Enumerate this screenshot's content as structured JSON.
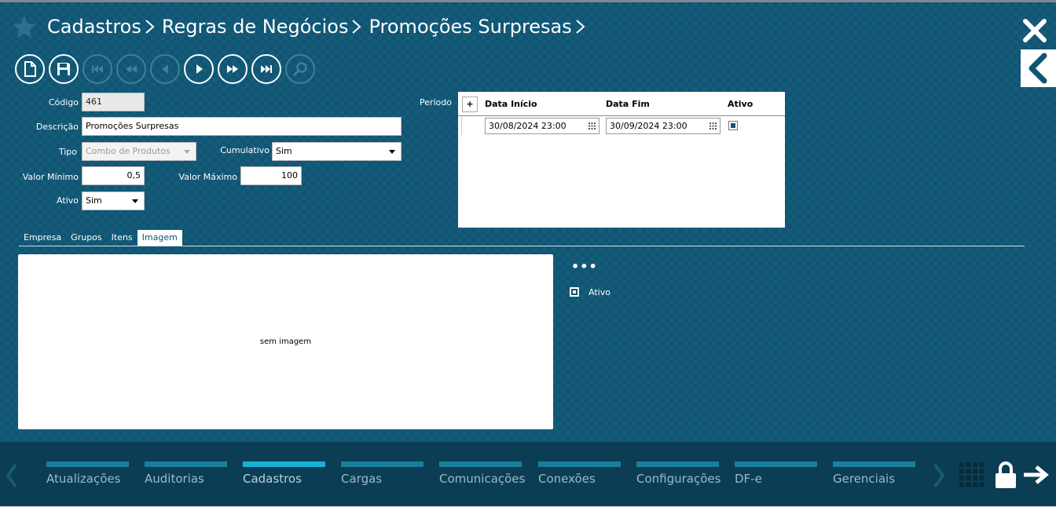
{
  "header": {
    "breadcrumbs": [
      "Cadastros",
      "Regras de Negócios",
      "Promoções Surpresas"
    ]
  },
  "form": {
    "codigo_label": "Código",
    "codigo_value": "461",
    "descricao_label": "Descrição",
    "descricao_value": "Promoções Surpresas",
    "tipo_label": "Tipo",
    "tipo_value": "Combo de Produtos",
    "cumulativo_label": "Cumulativo",
    "cumulativo_value": "Sim",
    "valor_minimo_label": "Valor Mínimo",
    "valor_minimo_value": "0,5",
    "valor_maximo_label": "Valor Máximo",
    "valor_maximo_value": "100",
    "ativo_label": "Ativo",
    "ativo_value": "Sim",
    "periodo_label": "Período"
  },
  "periodo_grid": {
    "add_label": "+",
    "columns": [
      "Data Início",
      "Data Fim",
      "Ativo"
    ],
    "rows": [
      {
        "inicio": "30/08/2024 23:00",
        "fim": "30/09/2024 23:00",
        "ativo": true
      }
    ]
  },
  "tabs": [
    {
      "label": "Empresa",
      "active": false
    },
    {
      "label": "Grupos",
      "active": false
    },
    {
      "label": "Itens",
      "active": false
    },
    {
      "label": "Imagem",
      "active": true
    }
  ],
  "imagem": {
    "placeholder": "sem imagem",
    "more_label": "•••",
    "ativo_label": "Ativo"
  },
  "footer": {
    "items": [
      {
        "label": "Atualizações",
        "active": false
      },
      {
        "label": "Auditorias",
        "active": false
      },
      {
        "label": "Cadastros",
        "active": true
      },
      {
        "label": "Cargas",
        "active": false
      },
      {
        "label": "Comunicações",
        "active": false
      },
      {
        "label": "Conexões",
        "active": false
      },
      {
        "label": "Configurações",
        "active": false
      },
      {
        "label": "DF-e",
        "active": false
      },
      {
        "label": "Gerenciais",
        "active": false
      }
    ]
  },
  "colors": {
    "background": "#0f5574",
    "footer": "#0b3e55",
    "nav_bar": "#1a7f9b",
    "nav_bar_active": "#1ab0d6"
  }
}
